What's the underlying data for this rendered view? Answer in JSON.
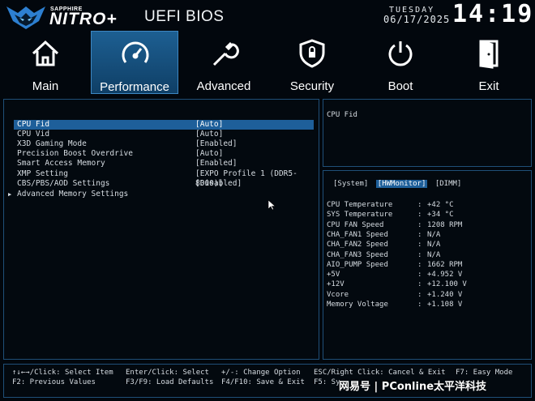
{
  "header": {
    "brand_sub": "SAPPHIRE",
    "brand_name": "NITRO+",
    "title": "UEFI BIOS",
    "day": "TUESDAY",
    "date": "06/17/2025",
    "time": "14:19"
  },
  "tabs": [
    {
      "label": "Main",
      "icon": "home-icon"
    },
    {
      "label": "Performance",
      "icon": "speedometer-icon",
      "active": true
    },
    {
      "label": "Advanced",
      "icon": "wrench-icon"
    },
    {
      "label": "Security",
      "icon": "shield-lock-icon"
    },
    {
      "label": "Boot",
      "icon": "power-icon"
    },
    {
      "label": "Exit",
      "icon": "exit-door-icon"
    }
  ],
  "settings": [
    {
      "label": "CPU Fid",
      "value": "[Auto]",
      "selected": true
    },
    {
      "label": "CPU Vid",
      "value": "[Auto]"
    },
    {
      "label": "X3D Gaming Mode",
      "value": "[Enabled]"
    },
    {
      "label": "Precision Boost Overdrive",
      "value": "[Auto]"
    },
    {
      "label": "Smart Access Memory",
      "value": "[Enabled]"
    },
    {
      "label": "XMP Setting",
      "value": "[EXPO Profile 1 (DDR5-8000)]"
    },
    {
      "label": "CBS/PBS/AOD Settings",
      "value": "[Disabled]"
    },
    {
      "label": "Advanced Memory Settings",
      "value": "",
      "submenu": true
    }
  ],
  "help_panel": {
    "text": "CPU Fid"
  },
  "hw_panel": {
    "tabs": [
      {
        "label": "[System]"
      },
      {
        "label": "[HWMonitor]",
        "active": true
      },
      {
        "label": "[DIMM]"
      }
    ],
    "readings": [
      {
        "label": "CPU Temperature",
        "value": "+42 °C"
      },
      {
        "label": "SYS Temperature",
        "value": "+34 °C"
      },
      {
        "label": "CPU FAN Speed",
        "value": "1208 RPM"
      },
      {
        "label": "CHA_FAN1 Speed",
        "value": "N/A"
      },
      {
        "label": "CHA_FAN2 Speed",
        "value": "N/A"
      },
      {
        "label": "CHA_FAN3 Speed",
        "value": "N/A"
      },
      {
        "label": "AIO_PUMP Speed",
        "value": "1662 RPM"
      },
      {
        "label": "+5V",
        "value": "+4.952 V"
      },
      {
        "label": "+12V",
        "value": "+12.100 V"
      },
      {
        "label": "Vcore",
        "value": "+1.240 V"
      },
      {
        "label": "Memory Voltage",
        "value": "+1.108 V"
      }
    ]
  },
  "footer": {
    "row1": [
      "↑↓←→/Click: Select Item",
      "Enter/Click: Select",
      "+/-: Change Option",
      "ESC/Right Click: Cancel & Exit",
      "F7: Easy Mode"
    ],
    "row2": [
      "F2: Previous Values",
      "F3/F9: Load Defaults",
      "F4/F10: Save & Exit",
      "F5: Sy"
    ]
  },
  "watermark": "网易号 | PConline太平洋科技"
}
